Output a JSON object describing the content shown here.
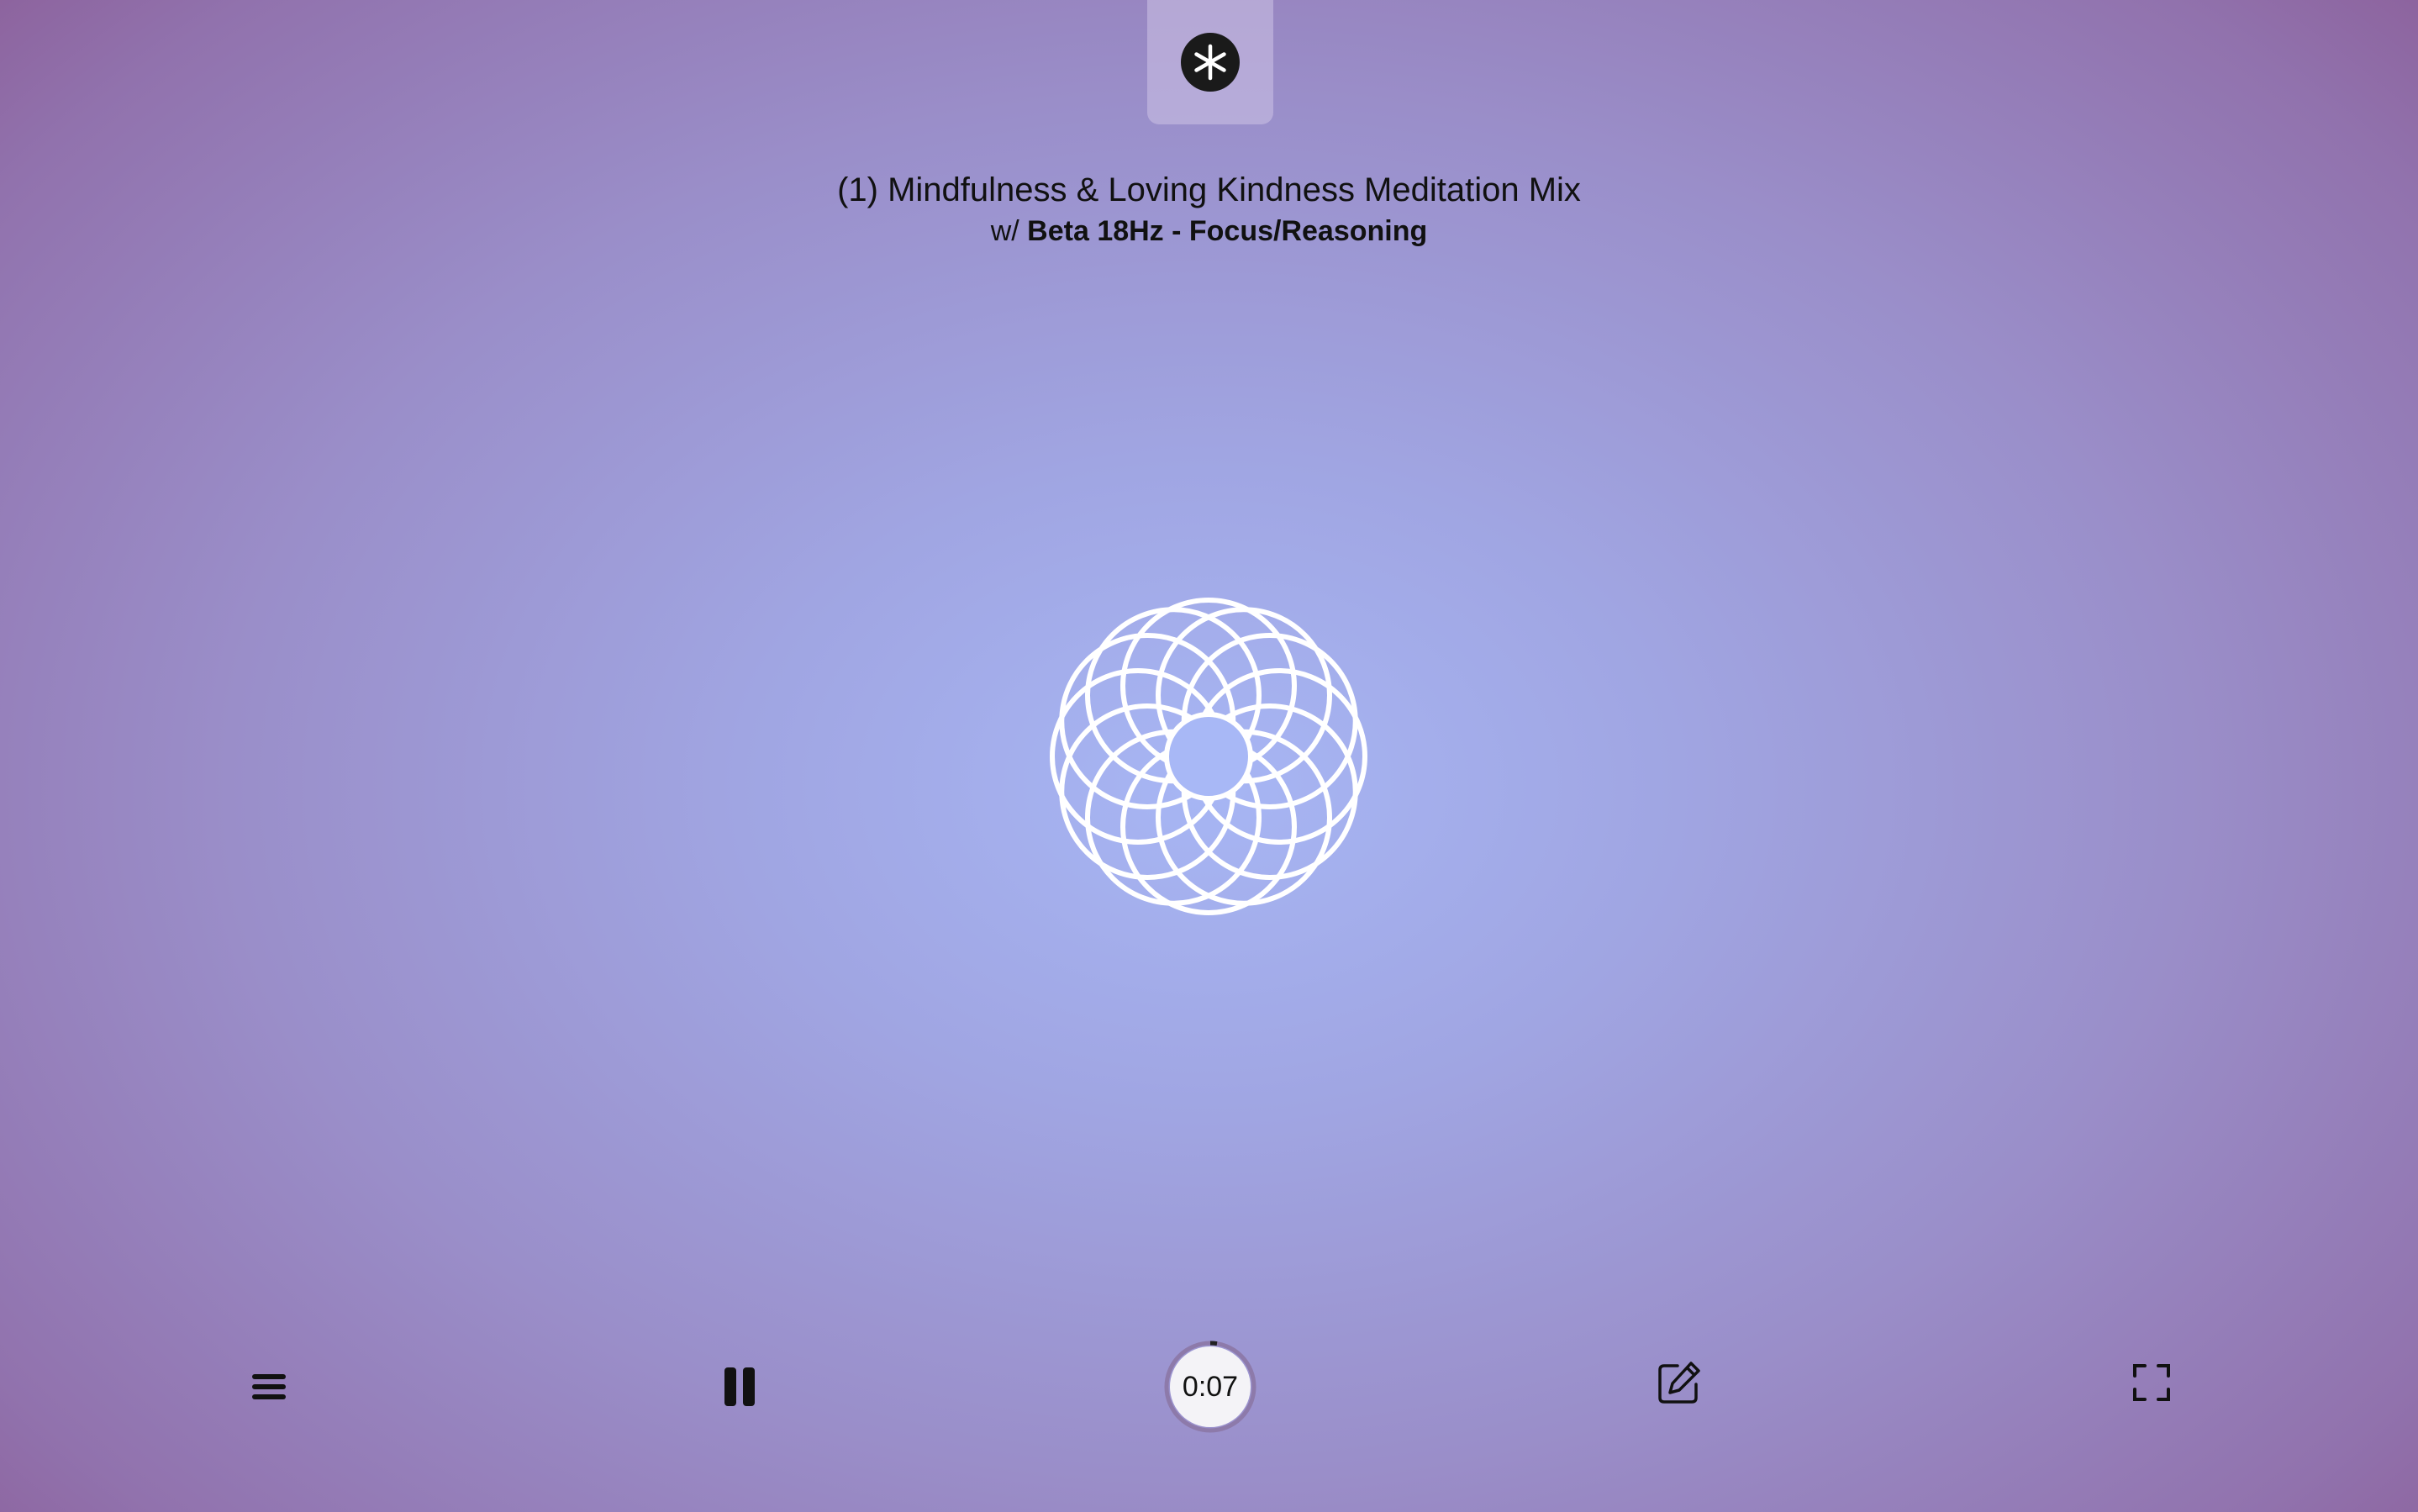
{
  "header": {
    "logo_icon": "asterisk-logo-icon"
  },
  "session": {
    "title": "(1) Mindfulness & Loving Kindness Meditation Mix",
    "subtitle_prefix": "w/",
    "brainwave": "Beta 18Hz - Focus/Reasoning"
  },
  "visual": {
    "icon": "flower-of-life-mandala",
    "stroke_color": "#ffffff",
    "center_color": "#a8b8f6"
  },
  "controls": {
    "menu_icon": "hamburger-menu-icon",
    "pause_icon": "pause-icon",
    "timer_display": "0:07",
    "edit_icon": "edit-note-icon",
    "fullscreen_icon": "fullscreen-icon"
  },
  "colors": {
    "background_center": "#a7b6f4",
    "background_edge": "#87508a",
    "icon_color": "#111111"
  }
}
